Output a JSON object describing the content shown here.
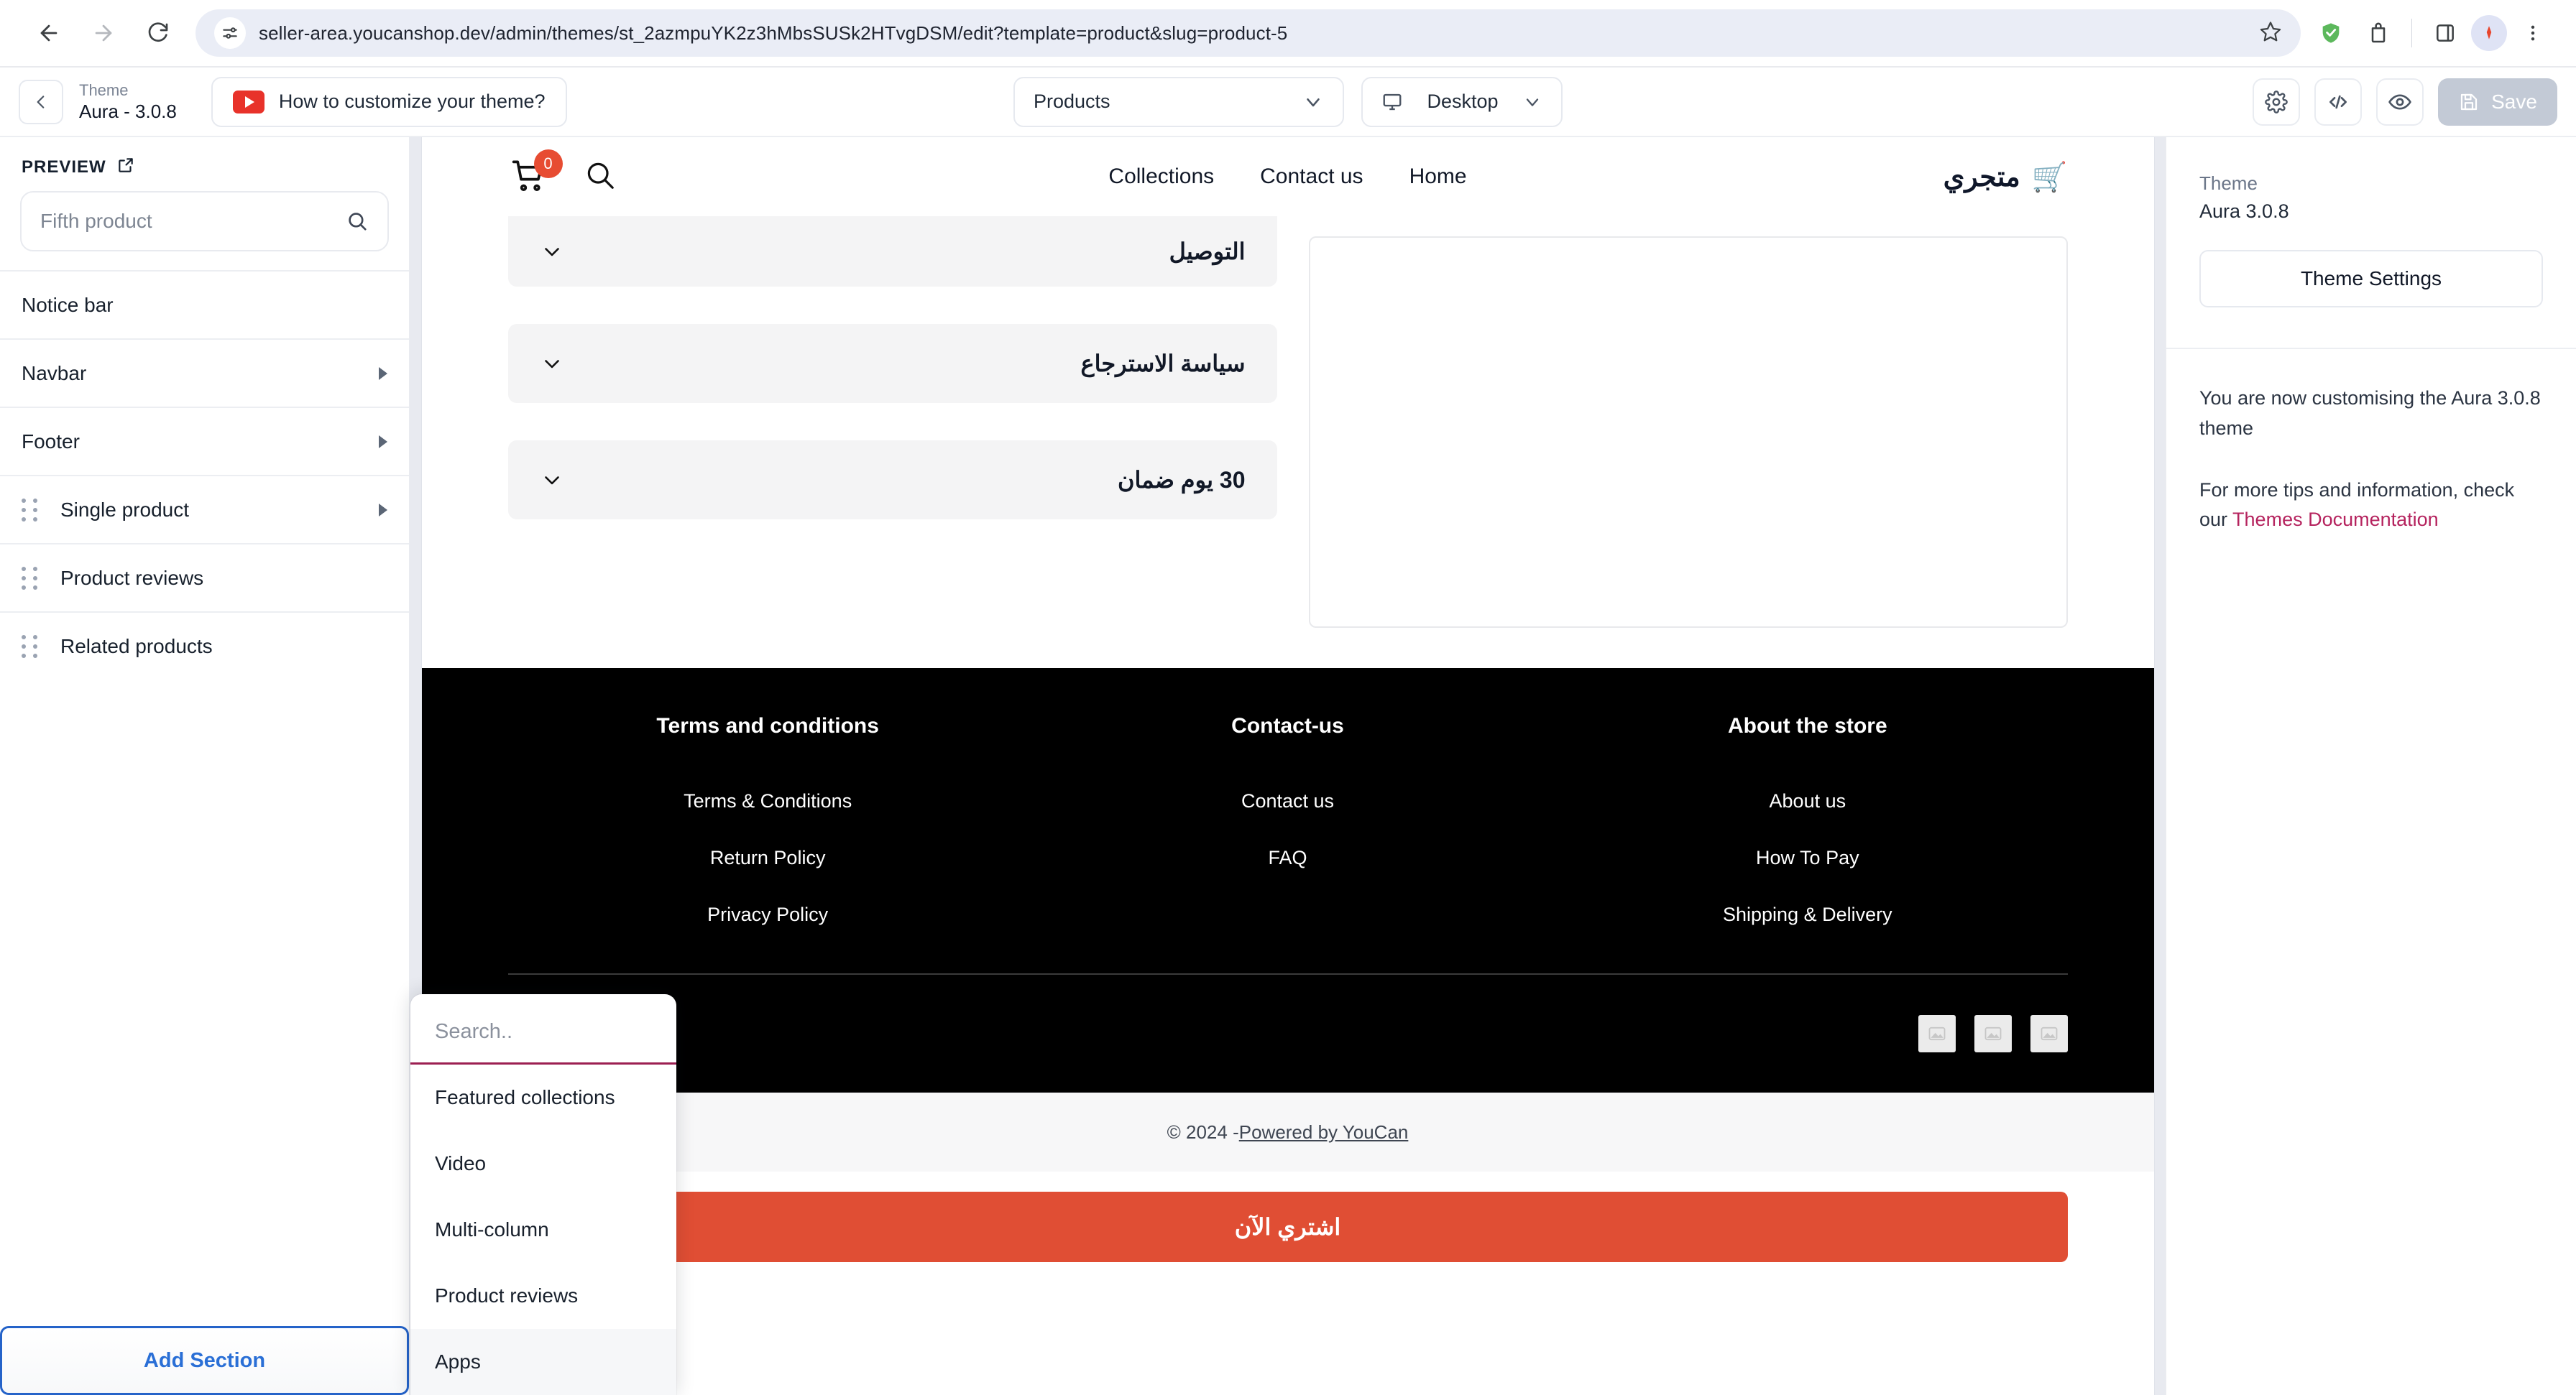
{
  "browser": {
    "url": "seller-area.youcanshop.dev/admin/themes/st_2azmpuYK2z3hMbsSUSk2HTvgDSM/edit?template=product&slug=product-5",
    "icons": {
      "back": "back-arrow-icon",
      "forward": "forward-arrow-icon",
      "reload": "reload-icon",
      "site_settings": "site-settings-icon",
      "bookmark": "star-icon",
      "extension_shield": "shield-extension-icon",
      "extension_generic": "extension-icon",
      "side_panel": "side-panel-icon",
      "profile": "profile-avatar-icon",
      "menu": "kebab-menu-icon"
    }
  },
  "toolbar": {
    "back_label": "back",
    "theme_caption": "Theme",
    "theme_name": "Aura - 3.0.8",
    "youtube_button": "How to customize your theme?",
    "template_select": "Products",
    "device_select": "Desktop",
    "settings_icon": "gear-icon",
    "code_icon": "code-icon",
    "preview_icon": "eye-icon",
    "save_label": "Save"
  },
  "sidebar": {
    "preview_heading": "PREVIEW",
    "search_placeholder": "Fifth product",
    "search_value": "",
    "sections": [
      {
        "label": "Notice bar",
        "draggable": false,
        "expandable": false
      },
      {
        "label": "Navbar",
        "draggable": false,
        "expandable": true
      },
      {
        "label": "Footer",
        "draggable": false,
        "expandable": true
      },
      {
        "label": "Single product",
        "draggable": true,
        "expandable": true
      },
      {
        "label": "Product reviews",
        "draggable": true,
        "expandable": false
      },
      {
        "label": "Related products",
        "draggable": true,
        "expandable": false
      }
    ],
    "add_section_label": "Add Section"
  },
  "add_section_popup": {
    "search_placeholder": "Search..",
    "search_value": "",
    "items": [
      "Featured collections",
      "Video",
      "Multi-column",
      "Product reviews",
      "Apps"
    ],
    "highlighted_index": 4,
    "accent_color": "#9c1f52"
  },
  "preview": {
    "store_nav": {
      "cart_count": "0",
      "cart_icon": "shopping-cart-icon",
      "search_icon": "search-icon",
      "menu": [
        "Collections",
        "Contact us",
        "Home"
      ],
      "logo_text": "متجري",
      "logo_icon": "shopping-cart-emoji"
    },
    "accordions": [
      {
        "title": "التوصيل",
        "icon": "chevron-down-icon"
      },
      {
        "title": "سياسة الاسترجاع",
        "icon": "chevron-down-icon"
      },
      {
        "title": "30 يوم ضمان",
        "icon": "chevron-down-icon"
      }
    ],
    "footer": {
      "columns": [
        {
          "heading": "Terms and conditions",
          "links": [
            "Terms & Conditions",
            "Return Policy",
            "Privacy Policy"
          ]
        },
        {
          "heading": "Contact-us",
          "links": [
            "Contact us",
            "FAQ"
          ]
        },
        {
          "heading": "About the store",
          "links": [
            "About us",
            "How To Pay",
            "Shipping & Delivery"
          ]
        }
      ],
      "social_placeholders": 3,
      "social_icon": "broken-image-icon"
    },
    "copyright_prefix": "© 2024 - ",
    "copyright_link": "Powered by YouCan",
    "buy_button": "اشتري الآن",
    "buy_button_color": "#e04e34"
  },
  "right_panel": {
    "theme_caption": "Theme",
    "theme_name": "Aura 3.0.8",
    "theme_settings_label": "Theme Settings",
    "info_line_1": "You are now customising the Aura 3.0.8 theme",
    "info_line_2_prefix": "For more tips and information, check our ",
    "info_link": "Themes Documentation",
    "link_color": "#b5235e"
  }
}
